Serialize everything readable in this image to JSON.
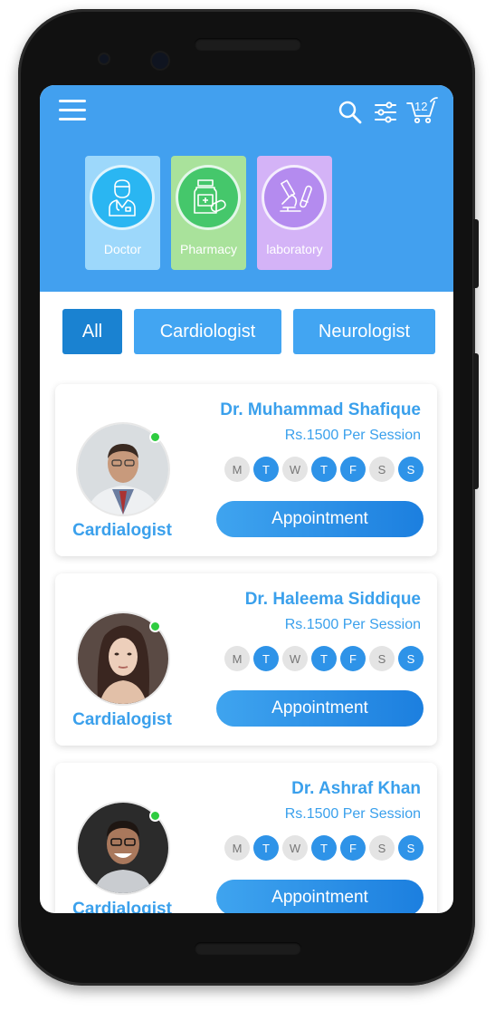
{
  "header": {
    "cart_count": "12",
    "categories": [
      {
        "label": "Doctor",
        "color": "#9dd8fb"
      },
      {
        "label": "Pharmacy",
        "color": "#a9e29b"
      },
      {
        "label": "laboratory",
        "color": "#d4b3f7"
      }
    ]
  },
  "filters": [
    {
      "label": "All",
      "active": true
    },
    {
      "label": "Cardiologist",
      "active": false
    },
    {
      "label": "Neurologist",
      "active": false
    }
  ],
  "doctors": [
    {
      "name": "Dr. Muhammad Shafique",
      "fee": "Rs.1500 Per Session",
      "specialty": "Cardialogist",
      "appointment_label": "Appointment",
      "days": [
        {
          "d": "M",
          "on": false
        },
        {
          "d": "T",
          "on": true
        },
        {
          "d": "W",
          "on": false
        },
        {
          "d": "T",
          "on": true
        },
        {
          "d": "F",
          "on": true
        },
        {
          "d": "S",
          "on": false
        },
        {
          "d": "S",
          "on": true
        }
      ]
    },
    {
      "name": "Dr. Haleema Siddique",
      "fee": "Rs.1500 Per Session",
      "specialty": "Cardialogist",
      "appointment_label": "Appointment",
      "days": [
        {
          "d": "M",
          "on": false
        },
        {
          "d": "T",
          "on": true
        },
        {
          "d": "W",
          "on": false
        },
        {
          "d": "T",
          "on": true
        },
        {
          "d": "F",
          "on": true
        },
        {
          "d": "S",
          "on": false
        },
        {
          "d": "S",
          "on": true
        }
      ]
    },
    {
      "name": "Dr. Ashraf Khan",
      "fee": "Rs.1500 Per Session",
      "specialty": "Cardialogist",
      "appointment_label": "Appointment",
      "days": [
        {
          "d": "M",
          "on": false
        },
        {
          "d": "T",
          "on": true
        },
        {
          "d": "W",
          "on": false
        },
        {
          "d": "T",
          "on": true
        },
        {
          "d": "F",
          "on": true
        },
        {
          "d": "S",
          "on": false
        },
        {
          "d": "S",
          "on": true
        }
      ]
    }
  ],
  "colors": {
    "header": "#42a0ef",
    "accent": "#3aa0ec",
    "active_filter": "#1a82d1",
    "inactive_filter": "#42a5f2",
    "online": "#2ecc40"
  }
}
